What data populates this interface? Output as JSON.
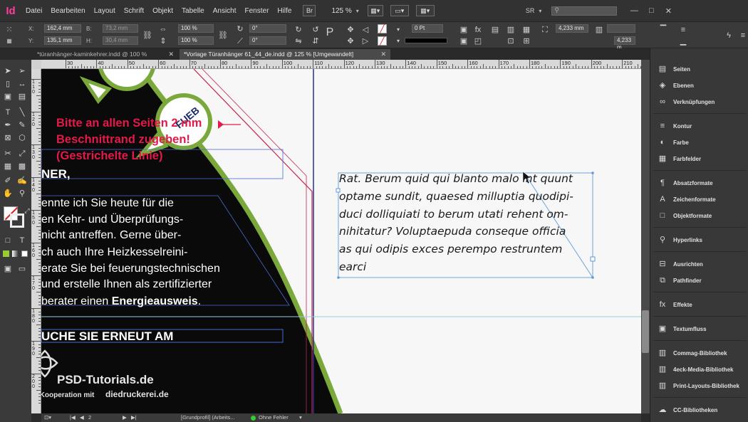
{
  "app": {
    "logo": "Id",
    "menu": [
      "Datei",
      "Bearbeiten",
      "Layout",
      "Schrift",
      "Objekt",
      "Tabelle",
      "Ansicht",
      "Fenster",
      "Hilfe"
    ],
    "bridge_label": "Br",
    "zoom": "125 %",
    "workspace": "SR",
    "window_controls": [
      "—",
      "□",
      "✕"
    ]
  },
  "control": {
    "x_label": "X:",
    "x_value": "162,4 mm",
    "y_label": "Y:",
    "y_value": "135,1 mm",
    "b_label": "B:",
    "b_value": "73,2 mm",
    "h_label": "H:",
    "h_value": "30,4 mm",
    "scale_x": "100 %",
    "scale_y": "100 %",
    "rotate": "0°",
    "shear": "0°",
    "stroke_weight": "0 Pt",
    "frame_w": "4,233 mm",
    "frame_h": "4,233 m"
  },
  "tabs": [
    {
      "label": "*türanhänger-kaminkehrer.indd @ 100 %",
      "close": "✕",
      "active": false
    },
    {
      "label": "*Vorlage Türanhänger 61_44_de.indd @ 125 % [Umgewandelt]",
      "close": "✕",
      "active": true
    }
  ],
  "ruler": {
    "h_labels": [
      "30",
      "40",
      "50",
      "60",
      "70",
      "80",
      "90",
      "100",
      "110",
      "120",
      "130",
      "140",
      "150",
      "160",
      "170",
      "180",
      "190",
      "200",
      "210",
      "220"
    ],
    "v_labels": [
      "1\n1\n0",
      "1\n2\n0",
      "1\n3\n0",
      "1\n4\n0",
      "1\n5\n0",
      "1\n6\n0",
      "1\n7\n0",
      "1\n8\n0",
      "1\n9\n0",
      "2\n0\n0"
    ]
  },
  "document": {
    "red_note": [
      "Bitte an allen Seiten 2 mm",
      "Beschnittrand zugeben!",
      "(Gestrichelte Linie)"
    ],
    "rotated_label": "FUEB",
    "headline_partial": "NER,",
    "body_lines": [
      "ennte ich Sie heute für die",
      "en Kehr- und Überprüfungs-",
      "nicht antreffen. Gerne über-",
      "ch auch Ihre Heizkesselreini-",
      "erate Sie bei feuerungstechnischen",
      "und erstelle Ihnen als zertifizierter",
      "berater einen "
    ],
    "body_bold": "Energieausweis",
    "body_end": ".",
    "second_headline": "UCHE SIE ERNEUT AM",
    "text_frame_lines": [
      "Rat. Berum quid qui blanto malo int quunt",
      "optame sundit, quaesed milluptia quodipi-",
      "duci dolliquiati to berum utati rehent om-",
      "nihitatur? Voluptaepuda conseque officia",
      "as qui odipis exces perempo restruntem",
      "earci"
    ]
  },
  "watermark": {
    "brand": "PSD-Tutorials.de",
    "coop": "in Kooperation mit",
    "partner": "diedruckerei.de"
  },
  "status": {
    "page": "2",
    "profile": "[Grundprofil] (Arbeits...",
    "preflight": "Ohne Fehler"
  },
  "panels": [
    {
      "icon": "pages-icon",
      "glyph": "▤",
      "label": "Seiten"
    },
    {
      "icon": "layers-icon",
      "glyph": "◈",
      "label": "Ebenen"
    },
    {
      "icon": "links-icon",
      "glyph": "∞",
      "label": "Verknüpfungen"
    },
    {
      "icon": "stroke-icon",
      "glyph": "≡",
      "label": "Kontur"
    },
    {
      "icon": "color-icon",
      "glyph": "◐",
      "label": "Farbe"
    },
    {
      "icon": "swatches-icon",
      "glyph": "▦",
      "label": "Farbfelder"
    },
    {
      "icon": "paragraph-styles-icon",
      "glyph": "¶",
      "label": "Absatzformate"
    },
    {
      "icon": "character-styles-icon",
      "glyph": "A",
      "label": "Zeichenformate"
    },
    {
      "icon": "object-styles-icon",
      "glyph": "□",
      "label": "Objektformate"
    },
    {
      "icon": "hyperlinks-icon",
      "glyph": "⚲",
      "label": "Hyperlinks"
    },
    {
      "icon": "align-icon",
      "glyph": "⊟",
      "label": "Ausrichten"
    },
    {
      "icon": "pathfinder-icon",
      "glyph": "⧉",
      "label": "Pathfinder"
    },
    {
      "icon": "effects-icon",
      "glyph": "fx",
      "label": "Effekte"
    },
    {
      "icon": "text-wrap-icon",
      "glyph": "▣",
      "label": "Textumfluss"
    },
    {
      "icon": "commag-library-icon",
      "glyph": "▥",
      "label": "Commag-Bibliothek"
    },
    {
      "icon": "4eck-library-icon",
      "glyph": "▥",
      "label": "4eck-Media-Bibliothek"
    },
    {
      "icon": "print-layouts-library-icon",
      "glyph": "▥",
      "label": "Print-Layouts-Bibliothek"
    },
    {
      "icon": "cc-libraries-icon",
      "glyph": "☁",
      "label": "CC-Bibliotheken"
    }
  ]
}
